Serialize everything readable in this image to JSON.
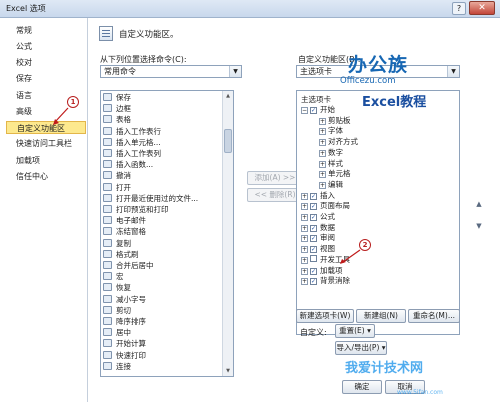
{
  "window": {
    "title": "Excel 选项",
    "help": "?",
    "close": "✕"
  },
  "nav": {
    "items": [
      "常规",
      "公式",
      "校对",
      "保存",
      "语言",
      "高级",
      "自定义功能区",
      "快速访问工具栏",
      "加载项",
      "信任中心"
    ],
    "selected_index": 6
  },
  "header": {
    "text": "自定义功能区。"
  },
  "left": {
    "label": "从下列位置选择命令(C):",
    "combo_value": "常用命令",
    "commands": [
      "保存",
      "边框",
      "表格",
      "插入工作表行",
      "插入单元格...",
      "插入工作表列",
      "插入函数...",
      "撤消",
      "打开",
      "打开最近使用过的文件...",
      "打印预览和打印",
      "电子邮件",
      "冻结窗格",
      "复制",
      "格式刷",
      "合并后居中",
      "宏",
      "恢复",
      "减小字号",
      "剪切",
      "降序排序",
      "居中",
      "开始计算",
      "快速打印",
      "连接"
    ]
  },
  "mid": {
    "add": "添加(A) >>",
    "remove": "<< 删除(R)"
  },
  "right": {
    "label": "自定义功能区(B):",
    "combo_value": "主选项卡",
    "tree_header": "主选项卡",
    "tree": [
      {
        "label": "开始",
        "level": 0,
        "exp": "⊟",
        "checked": true
      },
      {
        "label": "剪贴板",
        "level": 1,
        "exp": "⊞",
        "checked": false
      },
      {
        "label": "字体",
        "level": 1,
        "exp": "⊞",
        "checked": false
      },
      {
        "label": "对齐方式",
        "level": 1,
        "exp": "⊞",
        "checked": false
      },
      {
        "label": "数字",
        "level": 1,
        "exp": "⊞",
        "checked": false
      },
      {
        "label": "样式",
        "level": 1,
        "exp": "⊞",
        "checked": false
      },
      {
        "label": "单元格",
        "level": 1,
        "exp": "⊞",
        "checked": false
      },
      {
        "label": "编辑",
        "level": 1,
        "exp": "⊞",
        "checked": false
      },
      {
        "label": "插入",
        "level": 0,
        "exp": "⊞",
        "checked": true
      },
      {
        "label": "页面布局",
        "level": 0,
        "exp": "⊞",
        "checked": true
      },
      {
        "label": "公式",
        "level": 0,
        "exp": "⊞",
        "checked": true
      },
      {
        "label": "数据",
        "level": 0,
        "exp": "⊞",
        "checked": true
      },
      {
        "label": "审阅",
        "level": 0,
        "exp": "⊞",
        "checked": true
      },
      {
        "label": "视图",
        "level": 0,
        "exp": "⊞",
        "checked": true
      },
      {
        "label": "开发工具",
        "level": 0,
        "exp": "⊞",
        "checked": false
      },
      {
        "label": "加载项",
        "level": 0,
        "exp": "⊞",
        "checked": true
      },
      {
        "label": "背景消除",
        "level": 0,
        "exp": "⊞",
        "checked": true
      }
    ],
    "new_tab": "新建选项卡(W)",
    "new_group": "新建组(N)",
    "rename": "重命名(M)...",
    "customize_label": "自定义:",
    "reset": "重置(E) ▾",
    "import_export": "导入/导出(P) ▾"
  },
  "footer": {
    "ok": "确定",
    "cancel": "取消"
  },
  "annotations": {
    "one": "1",
    "two": "2"
  },
  "overlays": {
    "logo_cn": "办公族",
    "logo_en": "Officezu.com",
    "excel_tag": "Excel教程",
    "watermark": "我爱计技术网",
    "watermark_url": "www.5ifan.com"
  }
}
